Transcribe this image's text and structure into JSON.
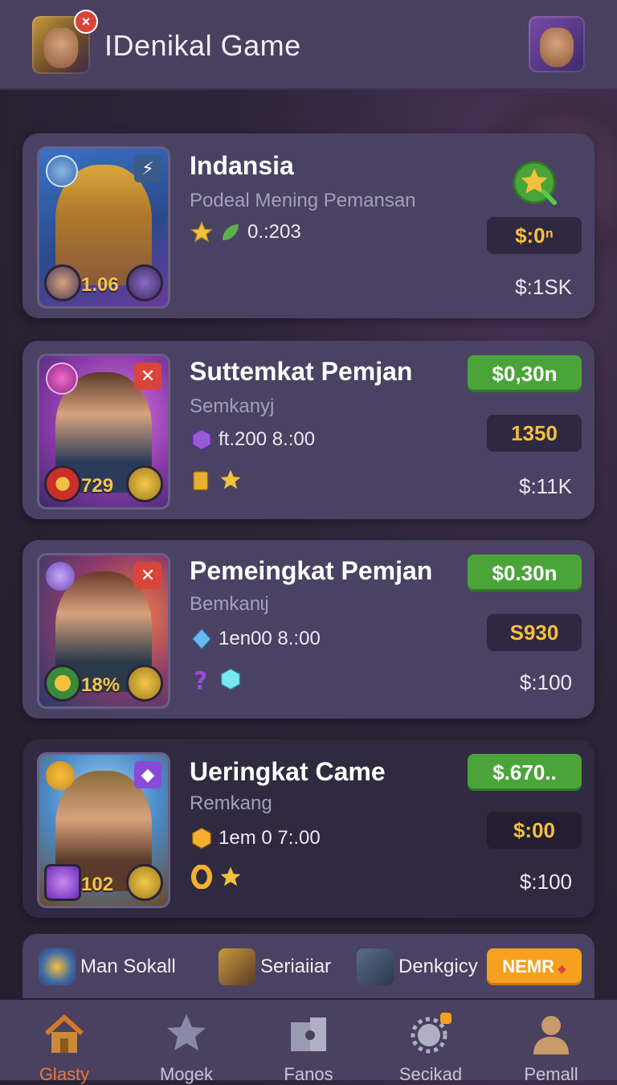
{
  "header": {
    "title": "IDenikal Game"
  },
  "cards": [
    {
      "title": "Indansia",
      "subtitle": "Podeal Mening Pemansan",
      "meta": "0.:203",
      "thumb_number": "1.06",
      "button": "$:0ⁿ",
      "price": "$:1SK"
    },
    {
      "title": "Suttemkat Pemjan",
      "subtitle": "Semkanyj",
      "meta": "ft.200 8.:00",
      "thumb_number": "729",
      "green": "$0,30n",
      "button": "1350",
      "price": "$:11K"
    },
    {
      "title": "Pemeingkat Pemjan",
      "subtitle": "Bemkanɩj",
      "meta": "1en00 8.:00",
      "thumb_number": "18%",
      "green": "$0.30n",
      "button": "S930",
      "price": "$:100"
    },
    {
      "title": "Ueringkat Came",
      "subtitle": "Remkang",
      "meta": "1em 0 7:.00",
      "thumb_number": "102",
      "green": "$.670..",
      "button": "$:00",
      "price": "$:100"
    }
  ],
  "strip": [
    {
      "label": "Man Sokall"
    },
    {
      "label": "Seriaiiar"
    },
    {
      "label": "Denkgicy"
    }
  ],
  "strip_button": "NEMR",
  "nav": [
    {
      "label": "Glasty",
      "icon": "home-icon"
    },
    {
      "label": "Mogek",
      "icon": "star-icon"
    },
    {
      "label": "Fanos",
      "icon": "puzzle-icon"
    },
    {
      "label": "Secikad",
      "icon": "gear-icon"
    },
    {
      "label": "Pemall",
      "icon": "profile-icon"
    }
  ],
  "colors": {
    "accent_green": "#4aa43a",
    "accent_gold": "#f5c040",
    "nav_active": "#e87a3a",
    "strip_button": "#f5a01e"
  }
}
